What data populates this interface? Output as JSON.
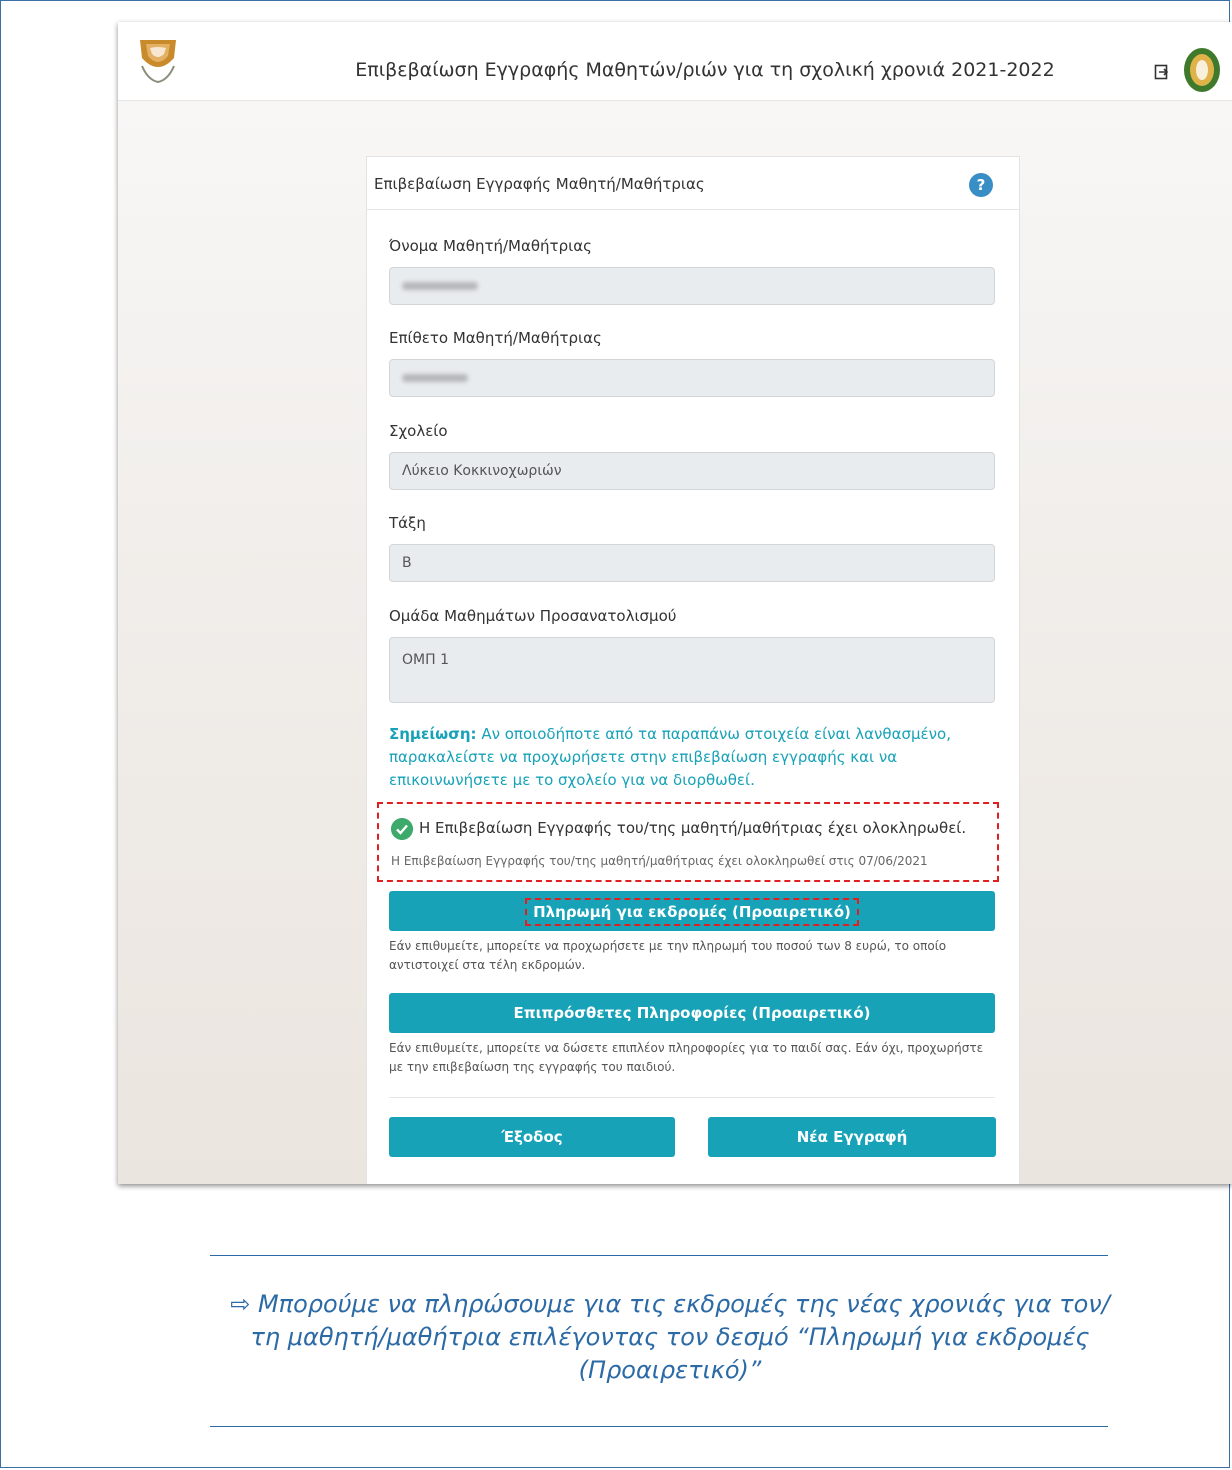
{
  "app": {
    "title": "Επιβεβαίωση Εγγραφής Μαθητών/ριών για τη σχολική χρονιά 2021-2022"
  },
  "card": {
    "title": "Επιβεβαίωση Εγγραφής Μαθητή/Μαθήτριας",
    "help_icon": "question-circle-icon",
    "fields": {
      "first_name_label": "Όνομα Μαθητή/Μαθήτριας",
      "first_name_value": "",
      "last_name_label": "Επίθετο Μαθητή/Μαθήτριας",
      "last_name_value": "",
      "school_label": "Σχολείο",
      "school_value": "Λύκειο Κοκκινοχωριών",
      "class_label": "Τάξη",
      "class_value": "Β",
      "group_label": "Ομάδα Μαθημάτων Προσανατολισμού",
      "group_value": "ΟΜΠ 1"
    },
    "note": {
      "label": "Σημείωση:",
      "text": "Αν οποιοδήποτε από τα παραπάνω στοιχεία είναι λανθασμένο, παρακαλείστε να προχωρήσετε στην επιβεβαίωση εγγραφής και να επικοινωνήσετε με το σχολείο για να διορθωθεί."
    },
    "status": {
      "title": "Η Επιβεβαίωση Εγγραφής του/της μαθητή/μαθήτριας έχει ολοκληρωθεί.",
      "detail": "Η Επιβεβαίωση Εγγραφής του/της μαθητή/μαθήτριας έχει ολοκληρωθεί στις 07/06/2021"
    },
    "payment": {
      "button_label": "Πληρωμή για εκδρομές (Προαιρετικό)",
      "help": "Εάν επιθυμείτε, μπορείτε να προχωρήσετε με την πληρωμή του ποσού των 8 ευρώ, το οποίο αντιστοιχεί στα τέλη εκδρομών."
    },
    "extra_info": {
      "button_label": "Επιπρόσθετες Πληροφορίες (Προαιρετικό)",
      "help": "Εάν επιθυμείτε, μπορείτε να δώσετε επιπλέον πληροφορίες για το παιδί σας. Εάν όχι, προχωρήστε με την επιβεβαίωση της εγγραφής του παιδιού."
    },
    "exit_label": "Έξοδος",
    "new_registration_label": "Νέα Εγγραφή"
  },
  "caption": {
    "arrow": "⇨",
    "text": "Μπορούμε να πληρώσουμε για τις εκδρομές της νέας χρονιάς για τον/τη μαθητή/μαθήτρια επιλέγοντας τον δεσμό “Πληρωμή για εκδρομές (Προαιρετικό)”"
  },
  "colors": {
    "accent": "#17a2b8",
    "highlight": "#e02020",
    "caption": "#2c6aa6",
    "success": "#3daa6b"
  }
}
